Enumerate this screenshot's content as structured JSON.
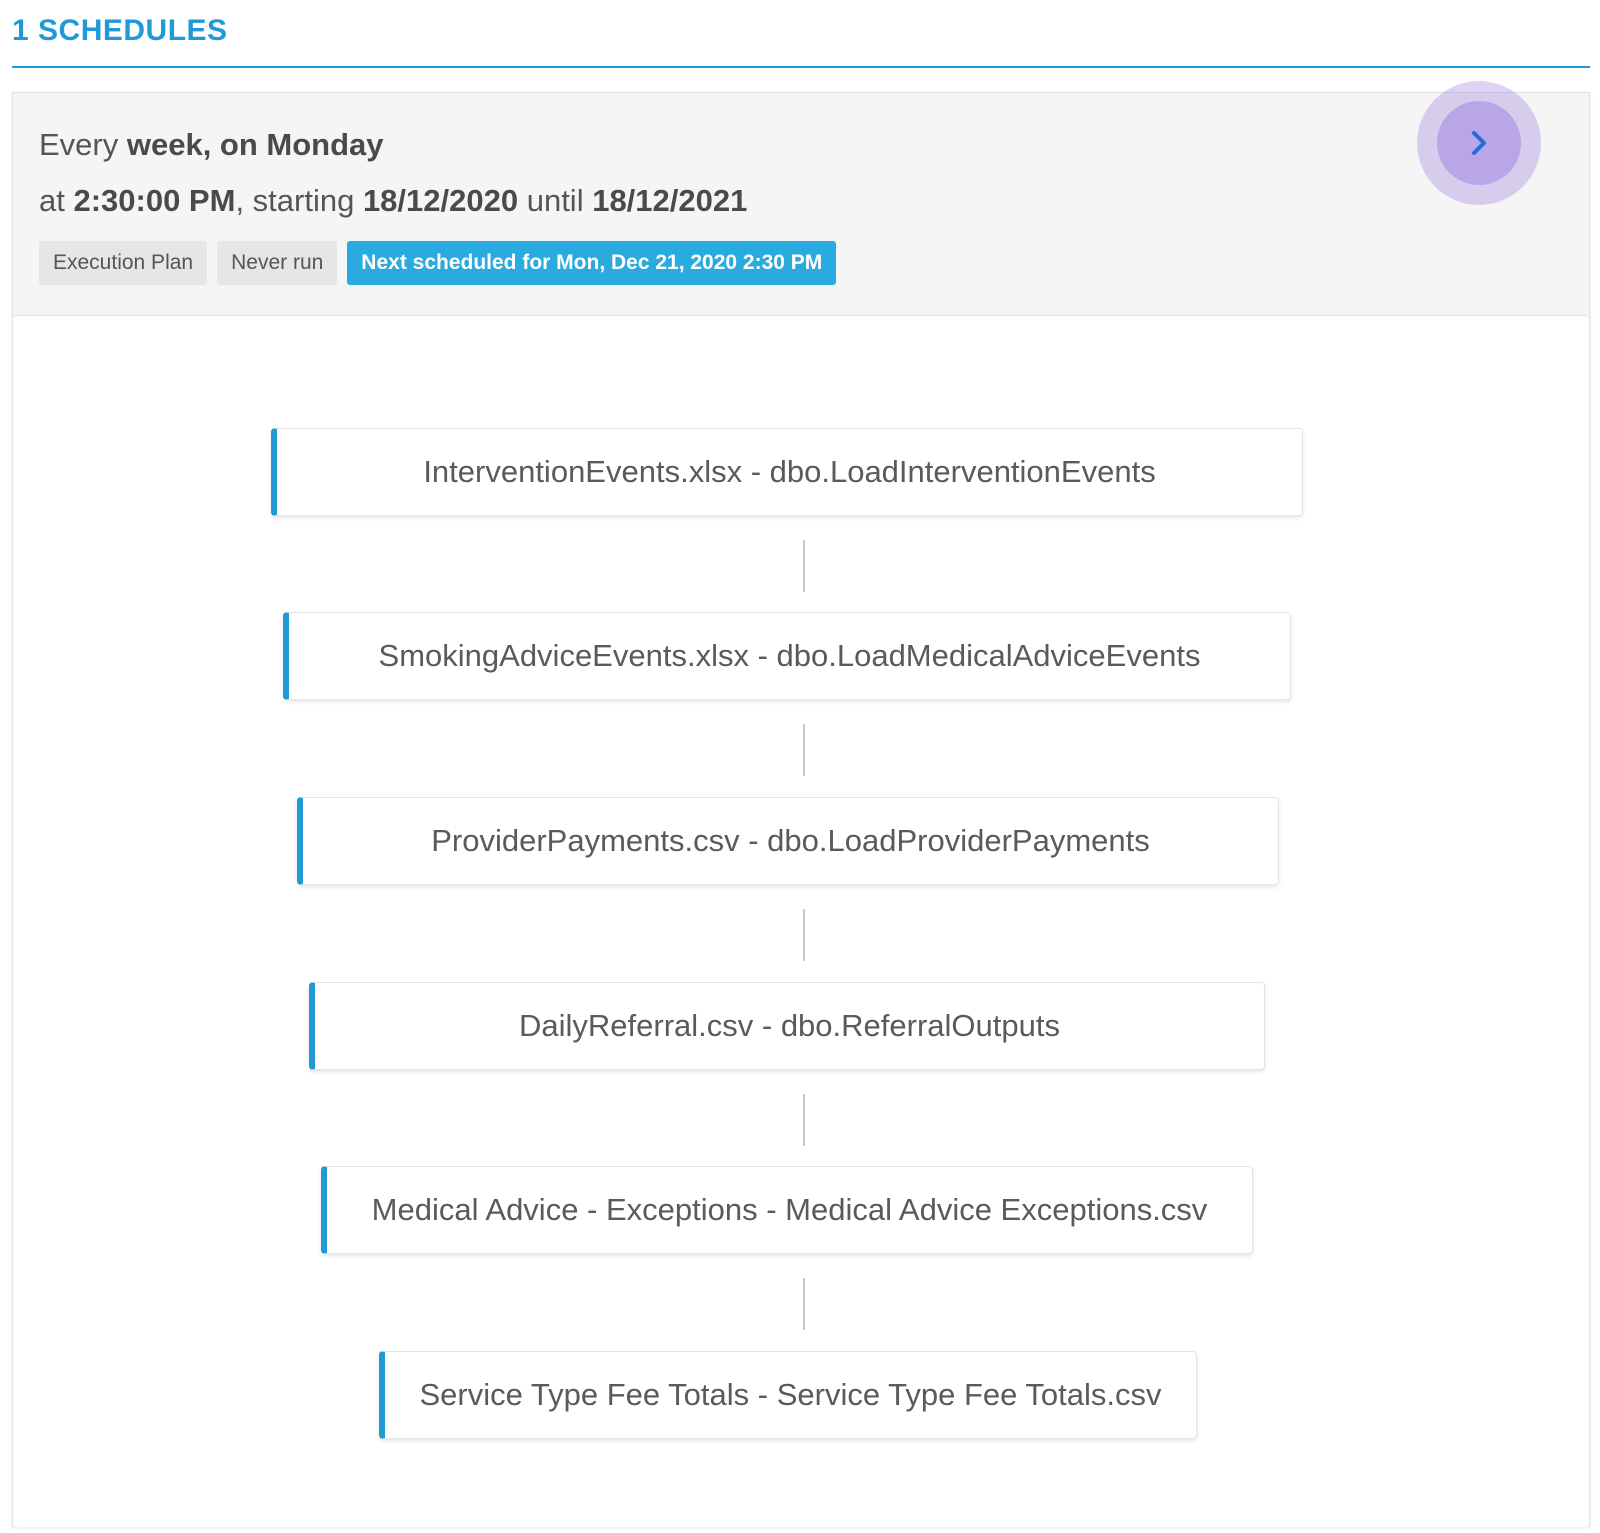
{
  "header": {
    "title": "1 SCHEDULES"
  },
  "schedule": {
    "line1_prefix": "Every ",
    "line1_frequency": "week, on Monday",
    "line2_prefix": "at ",
    "line2_time": "2:30:00 PM",
    "line2_starting": ", starting ",
    "line2_start_date": "18/12/2020",
    "line2_until": " until ",
    "line2_end_date": "18/12/2021",
    "badges": {
      "type": "Execution Plan",
      "last_run": "Never run",
      "next_run": "Next scheduled for Mon, Dec 21, 2020 2:30 PM"
    },
    "toggle_icon": "chevron-right-icon"
  },
  "plan": {
    "steps": [
      {
        "label": "InterventionEvents.xlsx - dbo.LoadInterventionEvents"
      },
      {
        "label": "SmokingAdviceEvents.xlsx - dbo.LoadMedicalAdviceEvents"
      },
      {
        "label": "ProviderPayments.csv - dbo.LoadProviderPayments"
      },
      {
        "label": "DailyReferral.csv - dbo.ReferralOutputs"
      },
      {
        "label": "Medical Advice - Exceptions - Medical Advice Exceptions.csv"
      },
      {
        "label": "Service Type Fee Totals - Service Type Fee Totals.csv"
      }
    ]
  },
  "colors": {
    "accent": "#1f9ad6",
    "next_badge": "#2aabdf",
    "toggle": "#b9a6e8",
    "chevron": "#1f6fd6"
  }
}
